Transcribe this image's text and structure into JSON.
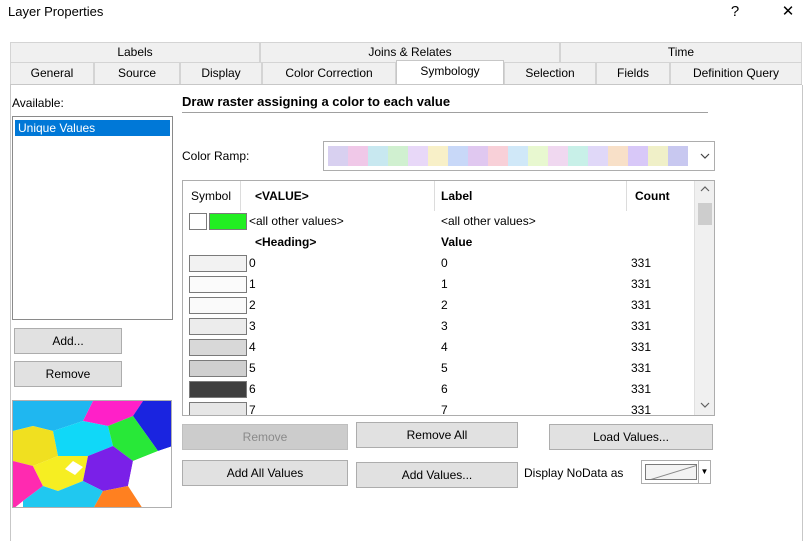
{
  "window": {
    "title": "Layer Properties",
    "help_label": "?",
    "close_label": "✕"
  },
  "tabs": {
    "row1": [
      "Labels",
      "Joins & Relates",
      "Time"
    ],
    "row2": [
      "General",
      "Source",
      "Display",
      "Color Correction",
      "Symbology",
      "Selection",
      "Fields",
      "Definition Query"
    ],
    "active": "Symbology"
  },
  "available": {
    "label": "Available:",
    "items": [
      "Unique Values"
    ],
    "add_label": "Add...",
    "remove_label": "Remove"
  },
  "main": {
    "heading": "Draw raster assigning a color to each value",
    "color_ramp_label": "Color Ramp:",
    "color_ramp_colors": [
      "#d8d0f0",
      "#f0c8e8",
      "#c8e8f0",
      "#d0f0d0",
      "#e8d8f8",
      "#f8f0c8",
      "#c8d8f8",
      "#e0c8f0",
      "#f8d0d8",
      "#d0e8f8",
      "#e8f8d0",
      "#f0d8f0",
      "#c8f0e8",
      "#e0d8f8",
      "#f8e0c8",
      "#d8c8f8",
      "#f0f0c8",
      "#c8c8f0"
    ],
    "chevron_icon": "chevron-down-icon"
  },
  "grid": {
    "headers": {
      "symbol": "Symbol",
      "value": "<VALUE>",
      "label": "Label",
      "count": "Count"
    },
    "other_row": {
      "value": "<all other values>",
      "label": "<all other values>",
      "swatch_color": "#22ee22"
    },
    "heading_row": {
      "value": "<Heading>",
      "label": "Value"
    },
    "rows": [
      {
        "value": "0",
        "label": "0",
        "count": "331",
        "color": "#f2f2f2"
      },
      {
        "value": "1",
        "label": "1",
        "count": "331",
        "color": "#fbfbfb"
      },
      {
        "value": "2",
        "label": "2",
        "count": "331",
        "color": "#fafafa"
      },
      {
        "value": "3",
        "label": "3",
        "count": "331",
        "color": "#ececec"
      },
      {
        "value": "4",
        "label": "4",
        "count": "331",
        "color": "#d8d8d8"
      },
      {
        "value": "5",
        "label": "5",
        "count": "331",
        "color": "#cfcfcf"
      },
      {
        "value": "6",
        "label": "6",
        "count": "331",
        "color": "#3f3f3f"
      },
      {
        "value": "7",
        "label": "7",
        "count": "331",
        "color": "#e6e6e6"
      }
    ]
  },
  "buttons": {
    "remove": "Remove",
    "remove_all": "Remove All",
    "load_values": "Load Values...",
    "add_all_values": "Add All Values",
    "add_values": "Add Values...",
    "display_nodata": "Display NoData as"
  }
}
